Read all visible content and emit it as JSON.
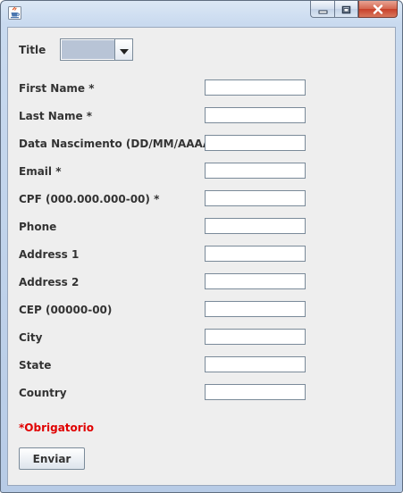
{
  "window": {
    "icon": "java-cup-icon",
    "controls": [
      "minimize-icon",
      "maximize-icon",
      "close-icon"
    ]
  },
  "form": {
    "title_label": "Title",
    "title_value": "",
    "fields": [
      {
        "label": "First Name *",
        "value": ""
      },
      {
        "label": "Last Name *",
        "value": ""
      },
      {
        "label": "Data Nascimento (DD/MM/AAAA) *",
        "value": ""
      },
      {
        "label": "Email *",
        "value": ""
      },
      {
        "label": "CPF (000.000.000-00) *",
        "value": ""
      },
      {
        "label": "Phone",
        "value": ""
      },
      {
        "label": "Address 1",
        "value": ""
      },
      {
        "label": "Address 2",
        "value": ""
      },
      {
        "label": "CEP (00000-00)",
        "value": ""
      },
      {
        "label": "City",
        "value": ""
      },
      {
        "label": "State",
        "value": ""
      },
      {
        "label": "Country",
        "value": ""
      }
    ],
    "required_note": "*Obrigatorio",
    "submit_label": "Enviar"
  },
  "colors": {
    "required": "#e00000",
    "panel": "#eeeeee"
  }
}
